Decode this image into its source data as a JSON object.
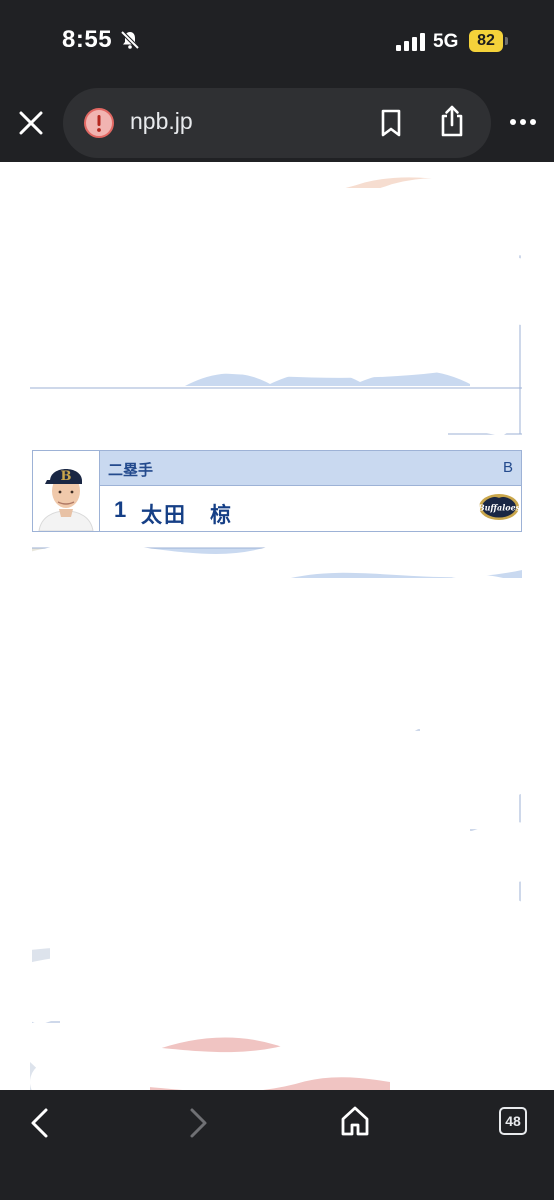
{
  "status_bar": {
    "time": "8:55",
    "network": "5G",
    "battery": "82"
  },
  "browser": {
    "url": "npb.jp"
  },
  "player_card": {
    "position": "二塁手",
    "league": "B",
    "number": "1",
    "name": "太田　椋",
    "team_logo_text": "Buffaloes"
  },
  "bottom_toolbar": {
    "tab_count": "48"
  }
}
